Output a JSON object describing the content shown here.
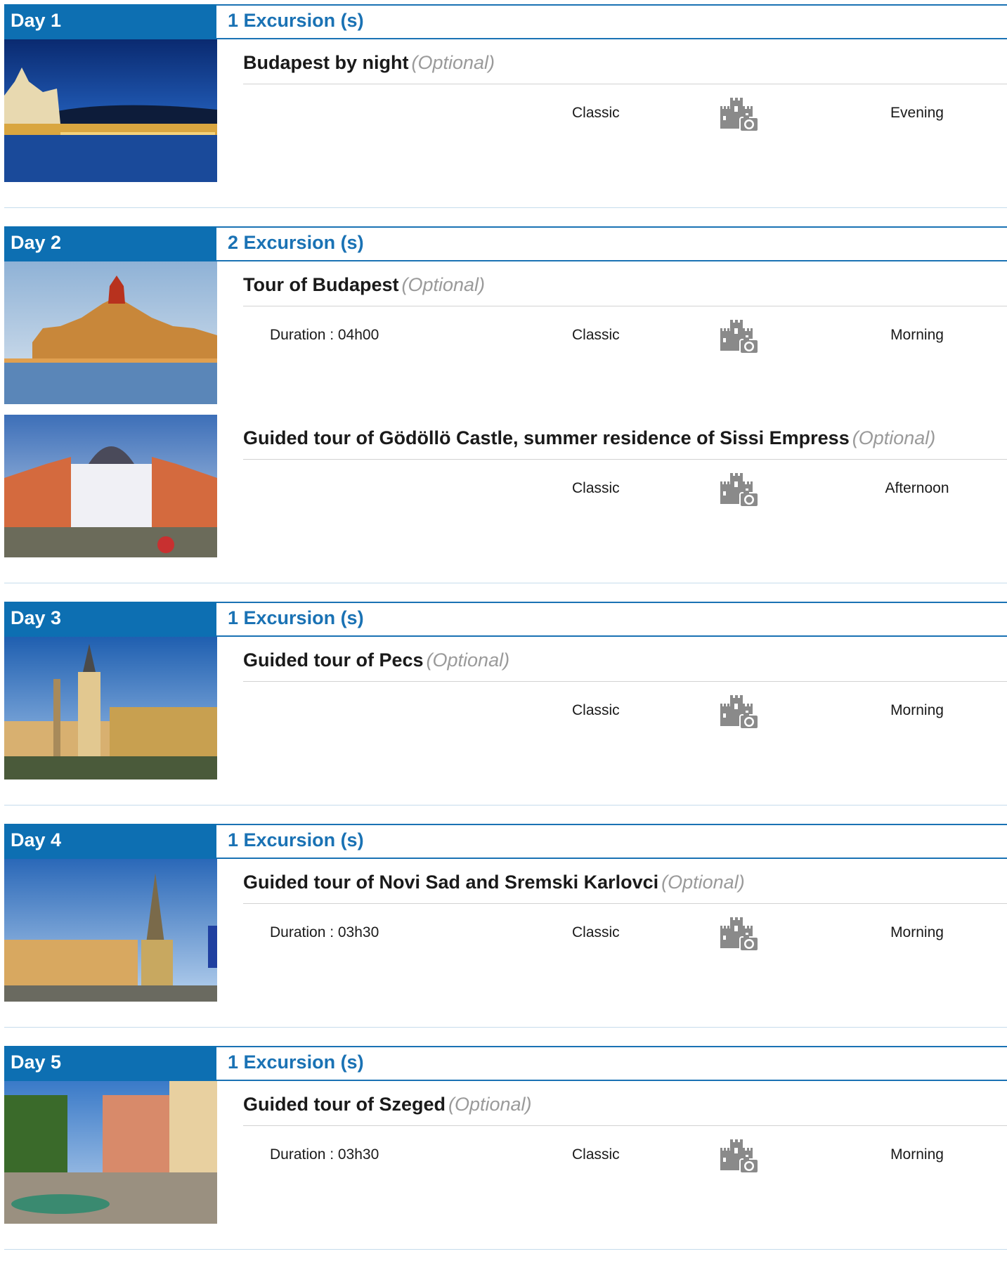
{
  "days": [
    {
      "label": "Day 1",
      "count": "1 Excursion (s)",
      "excursions": [
        {
          "title": "Budapest by night",
          "optional": "(Optional)",
          "duration": "",
          "level": "Classic",
          "time": "Evening",
          "icon": "castle-camera-icon",
          "photo": "night"
        }
      ]
    },
    {
      "label": "Day 2",
      "count": "2 Excursion (s)",
      "excursions": [
        {
          "title": "Tour of Budapest",
          "optional": "(Optional)",
          "duration": "Duration : 04h00",
          "level": "Classic",
          "time": "Morning",
          "icon": "castle-camera-icon",
          "photo": "parliament"
        },
        {
          "title": "Guided tour of Gödöllö Castle, summer residence of Sissi Empress",
          "optional": "(Optional)",
          "duration": "",
          "level": "Classic",
          "time": "Afternoon",
          "icon": "castle-camera-icon",
          "photo": "castle"
        }
      ]
    },
    {
      "label": "Day 3",
      "count": "1 Excursion (s)",
      "excursions": [
        {
          "title": "Guided tour of Pecs",
          "optional": "(Optional)",
          "duration": "",
          "level": "Classic",
          "time": "Morning",
          "icon": "castle-camera-icon",
          "photo": "pecs"
        }
      ]
    },
    {
      "label": "Day 4",
      "count": "1 Excursion (s)",
      "excursions": [
        {
          "title": "Guided tour of Novi Sad and Sremski Karlovci",
          "optional": "(Optional)",
          "duration": "Duration : 03h30",
          "level": "Classic",
          "time": "Morning",
          "icon": "castle-camera-icon",
          "photo": "novisad"
        }
      ]
    },
    {
      "label": "Day 5",
      "count": "1 Excursion (s)",
      "excursions": [
        {
          "title": "Guided tour of Szeged",
          "optional": "(Optional)",
          "duration": "Duration : 03h30",
          "level": "Classic",
          "time": "Morning",
          "icon": "castle-camera-icon",
          "photo": "szeged"
        }
      ]
    }
  ],
  "colors": {
    "accent": "#0d6fb2",
    "optional_text": "#9a9a9a",
    "divider": "#c6dcec",
    "icon_gray": "#8a8a8a"
  }
}
